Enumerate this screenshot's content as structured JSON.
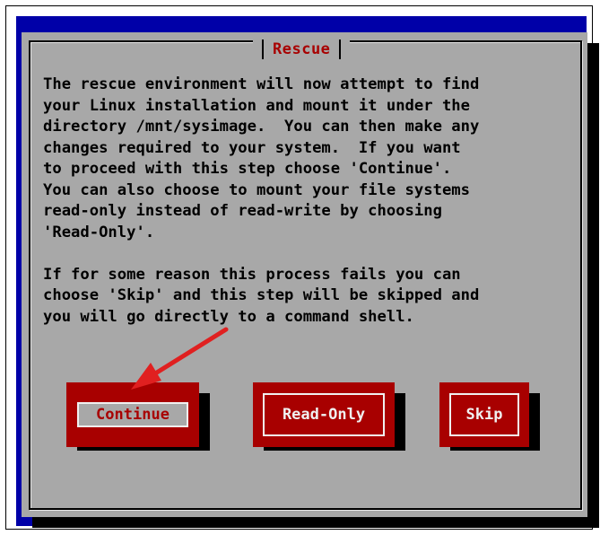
{
  "dialog": {
    "title": "Rescue",
    "message": "The rescue environment will now attempt to find\nyour Linux installation and mount it under the\ndirectory /mnt/sysimage.  You can then make any\nchanges required to your system.  If you want\nto proceed with this step choose 'Continue'.\nYou can also choose to mount your file systems\nread-only instead of read-write by choosing\n'Read-Only'.\n\nIf for some reason this process fails you can\nchoose 'Skip' and this step will be skipped and\nyou will go directly to a command shell."
  },
  "buttons": {
    "continue_label": "Continue",
    "readonly_label": "Read-Only",
    "skip_label": "Skip"
  },
  "colors": {
    "background_blue": "#0000a8",
    "dialog_gray": "#a8a8a8",
    "button_red": "#a80000",
    "arrow_red": "#e02020"
  }
}
